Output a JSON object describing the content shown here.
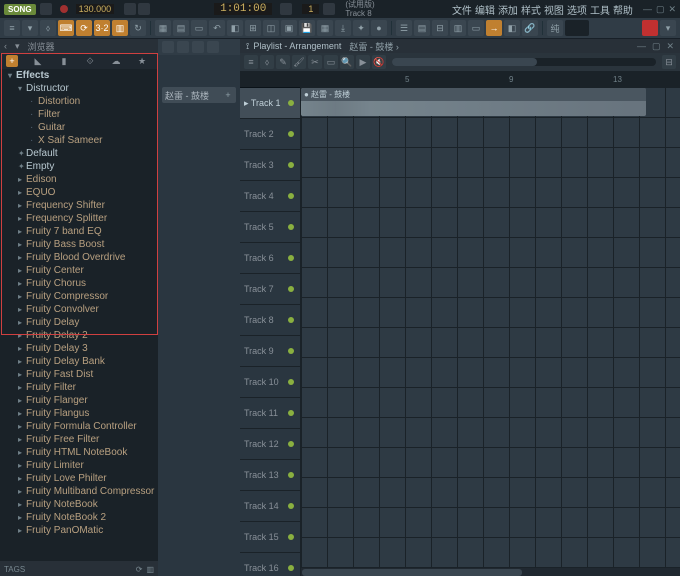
{
  "title": {
    "song_btn": "SONG",
    "bpm": "130.000",
    "time": "   1:01:00",
    "pattern": "1",
    "trk_line1": "(试用版)",
    "trk_line2": "Track 8"
  },
  "menu": [
    "文件",
    "编辑",
    "添加",
    "样式",
    "视图",
    "选项",
    "工具",
    "帮助"
  ],
  "sidebar": {
    "header": "浏览器",
    "tree": [
      {
        "t": "Effects",
        "c": "hdr",
        "a": "▾"
      },
      {
        "t": "Distructor",
        "c": "sub1",
        "a": "▾"
      },
      {
        "t": "Distortion",
        "c": "sub2"
      },
      {
        "t": "Filter",
        "c": "sub2"
      },
      {
        "t": "Guitar",
        "c": "sub2"
      },
      {
        "t": "X Saif Sameer",
        "c": "sub2"
      },
      {
        "t": "Default",
        "c": "sub1",
        "a": "✦"
      },
      {
        "t": "Empty",
        "c": "sub1",
        "a": "✦"
      },
      {
        "t": "Edison",
        "c": "sub1b",
        "a": "▸"
      },
      {
        "t": "EQUO",
        "c": "sub1b",
        "a": "▸"
      },
      {
        "t": "Frequency Shifter",
        "c": "sub1b",
        "a": "▸"
      },
      {
        "t": "Frequency Splitter",
        "c": "sub1b",
        "a": "▸"
      },
      {
        "t": "Fruity 7 band EQ",
        "c": "sub1b",
        "a": "▸"
      },
      {
        "t": "Fruity Bass Boost",
        "c": "sub1b",
        "a": "▸"
      },
      {
        "t": "Fruity Blood Overdrive",
        "c": "sub1b",
        "a": "▸"
      },
      {
        "t": "Fruity Center",
        "c": "sub1b",
        "a": "▸"
      },
      {
        "t": "Fruity Chorus",
        "c": "sub1b",
        "a": "▸"
      },
      {
        "t": "Fruity Compressor",
        "c": "sub1b",
        "a": "▸"
      },
      {
        "t": "Fruity Convolver",
        "c": "sub1b",
        "a": "▸"
      },
      {
        "t": "Fruity Delay",
        "c": "sub1b",
        "a": "▸"
      },
      {
        "t": "Fruity Delay 2",
        "c": "sub1b",
        "a": "▸"
      },
      {
        "t": "Fruity Delay 3",
        "c": "sub1b",
        "a": "▸"
      },
      {
        "t": "Fruity Delay Bank",
        "c": "sub1b",
        "a": "▸"
      },
      {
        "t": "Fruity Fast Dist",
        "c": "sub1b",
        "a": "▸"
      },
      {
        "t": "Fruity Filter",
        "c": "sub1b",
        "a": "▸"
      },
      {
        "t": "Fruity Flanger",
        "c": "sub1b",
        "a": "▸"
      },
      {
        "t": "Fruity Flangus",
        "c": "sub1b",
        "a": "▸"
      },
      {
        "t": "Fruity Formula Controller",
        "c": "sub1b",
        "a": "▸"
      },
      {
        "t": "Fruity Free Filter",
        "c": "sub1b",
        "a": "▸"
      },
      {
        "t": "Fruity HTML NoteBook",
        "c": "sub1b",
        "a": "▸"
      },
      {
        "t": "Fruity Limiter",
        "c": "sub1b",
        "a": "▸"
      },
      {
        "t": "Fruity Love Philter",
        "c": "sub1b",
        "a": "▸"
      },
      {
        "t": "Fruity Multiband Compressor",
        "c": "sub1b",
        "a": "▸"
      },
      {
        "t": "Fruity NoteBook",
        "c": "sub1b",
        "a": "▸"
      },
      {
        "t": "Fruity NoteBook 2",
        "c": "sub1b",
        "a": "▸"
      },
      {
        "t": "Fruity PanOMatic",
        "c": "sub1b",
        "a": "▸"
      }
    ],
    "tags": "TAGS"
  },
  "channel": {
    "label": "赵雷 - 鼓楼"
  },
  "playlist": {
    "header_prefix": "Playlist - Arrangement",
    "crumbs": "赵雷 - 鼓楼 ›",
    "tracks": [
      "Track 1",
      "Track 2",
      "Track 3",
      "Track 4",
      "Track 5",
      "Track 6",
      "Track 7",
      "Track 8",
      "Track 9",
      "Track 10",
      "Track 11",
      "Track 12",
      "Track 13",
      "Track 14",
      "Track 15",
      "Track 16"
    ],
    "ruler": [
      "5",
      "9",
      "13"
    ],
    "clip_label": "● 赵雷 - 鼓楼"
  },
  "stats": "纯"
}
